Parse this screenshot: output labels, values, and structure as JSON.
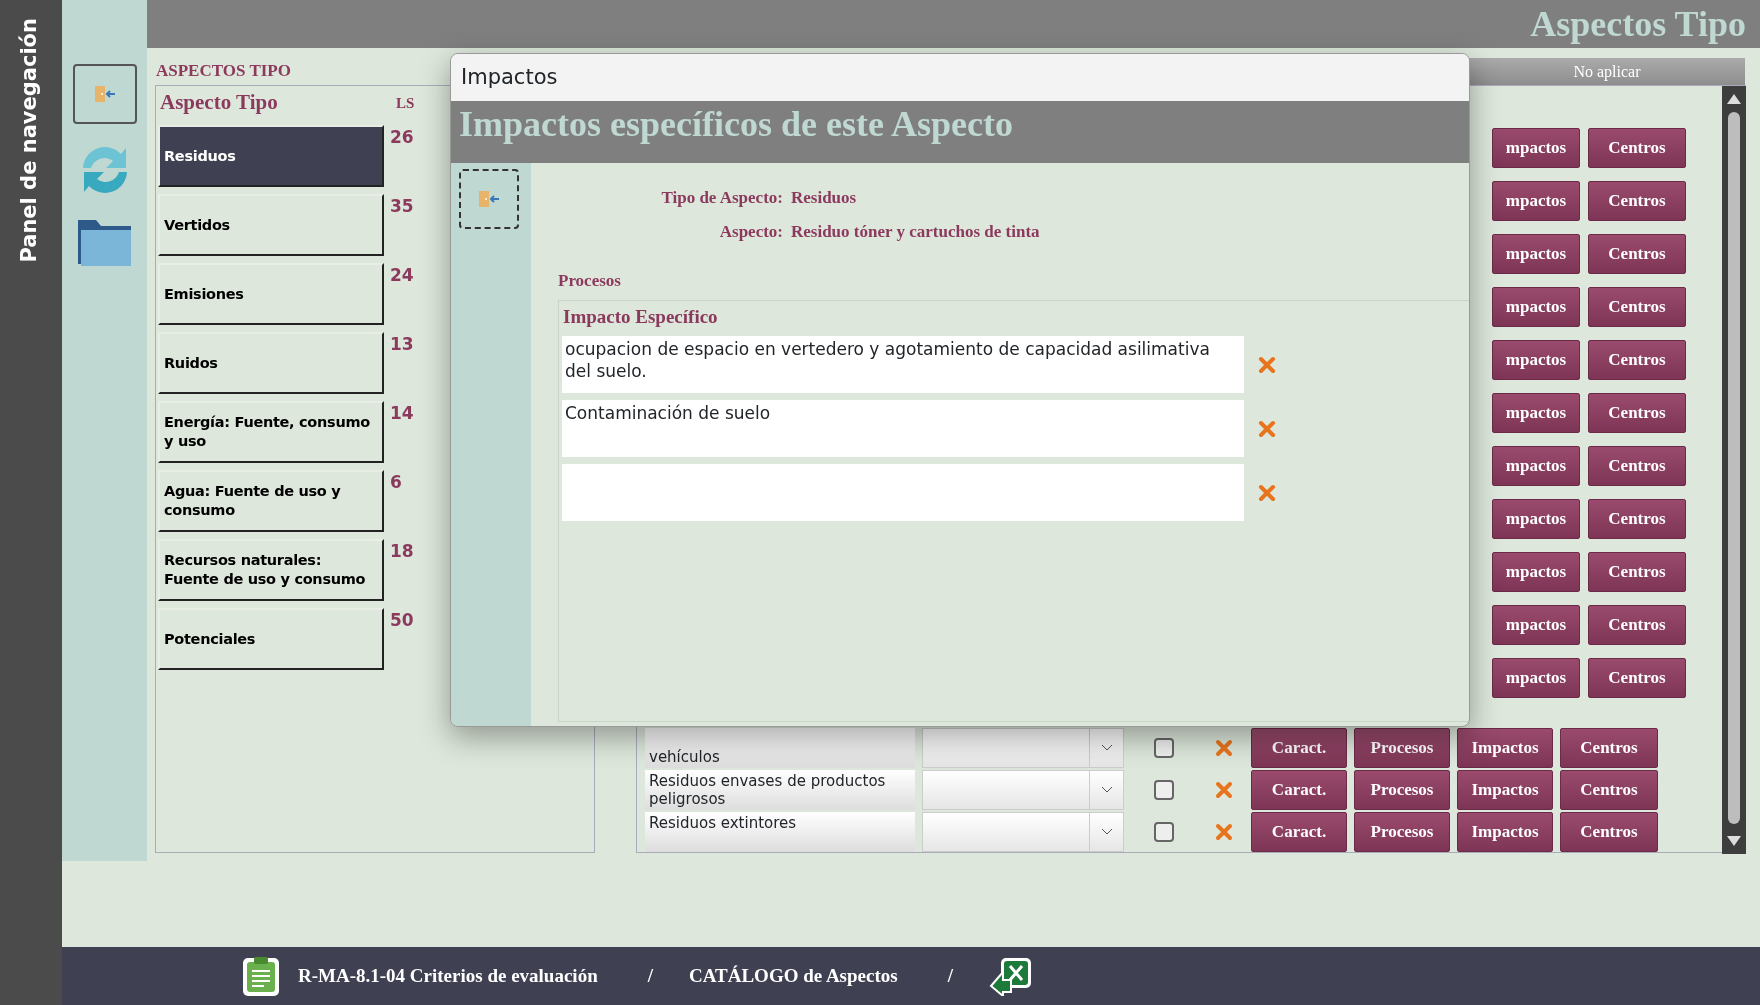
{
  "nav_panel": {
    "title": "Panel de navegación"
  },
  "header": {
    "title": "Aspectos Tipo"
  },
  "aspect_types": {
    "label": "ASPECTOS TIPO",
    "columns": [
      "Aspecto Tipo",
      "LS"
    ],
    "items": [
      {
        "name": "Residuos",
        "count": "26",
        "selected": true
      },
      {
        "name": "Vertidos",
        "count": "35",
        "selected": false
      },
      {
        "name": "Emisiones",
        "count": "24",
        "selected": false
      },
      {
        "name": "Ruidos",
        "count": "13",
        "selected": false
      },
      {
        "name": "Energía: Fuente, consumo y uso",
        "count": "14",
        "selected": false
      },
      {
        "name": "Agua: Fuente  de uso y consumo",
        "count": "6",
        "selected": false
      },
      {
        "name": "Recursos naturales: Fuente de uso  y consumo",
        "count": "18",
        "selected": false
      },
      {
        "name": "Potenciales",
        "count": "50",
        "selected": false
      }
    ]
  },
  "aspects_table": {
    "column_header": "No aplicar",
    "rows": [
      {
        "kind": "partial",
        "buttons": [
          "mpactos",
          "Centros"
        ]
      },
      {
        "kind": "partial",
        "buttons": [
          "mpactos",
          "Centros"
        ]
      },
      {
        "kind": "partial",
        "buttons": [
          "mpactos",
          "Centros"
        ]
      },
      {
        "kind": "partial",
        "buttons": [
          "mpactos",
          "Centros"
        ]
      },
      {
        "kind": "partial",
        "buttons": [
          "mpactos",
          "Centros"
        ]
      },
      {
        "kind": "partial",
        "buttons": [
          "mpactos",
          "Centros"
        ]
      },
      {
        "kind": "partial",
        "buttons": [
          "mpactos",
          "Centros"
        ]
      },
      {
        "kind": "partial",
        "buttons": [
          "mpactos",
          "Centros"
        ]
      },
      {
        "kind": "partial",
        "buttons": [
          "mpactos",
          "Centros"
        ]
      },
      {
        "kind": "partial",
        "buttons": [
          "mpactos",
          "Centros"
        ]
      },
      {
        "kind": "partial",
        "buttons": [
          "mpactos",
          "Centros"
        ]
      },
      {
        "kind": "full",
        "aspect": "vehículos",
        "checked": false,
        "buttons": [
          "Caract.",
          "Procesos",
          "Impactos",
          "Centros"
        ]
      },
      {
        "kind": "full",
        "aspect": "Residuos envases de productos peligrosos",
        "checked": false,
        "buttons": [
          "Caract.",
          "Procesos",
          "Impactos",
          "Centros"
        ]
      },
      {
        "kind": "full",
        "aspect": "Residuos extintores",
        "checked": false,
        "buttons": [
          "Caract.",
          "Procesos",
          "Impactos",
          "Centros"
        ]
      }
    ]
  },
  "dialog": {
    "title": "Impactos",
    "heading": "Impactos específicos de este Aspecto",
    "fields": [
      {
        "label": "Tipo de Aspecto:",
        "value": "Residuos"
      },
      {
        "label": "Aspecto:",
        "value": "Residuo tóner y cartuchos de tinta"
      }
    ],
    "section": "Procesos",
    "subform": {
      "header": "Impacto Específico",
      "rows": [
        {
          "kind": "record",
          "text": "ocupacion de espacio en vertedero y agotamiento de capacidad asilimativa del suelo."
        },
        {
          "kind": "record",
          "text": "Contaminación de suelo"
        },
        {
          "kind": "new"
        }
      ]
    }
  },
  "footer": {
    "items": [
      {
        "kind": "clipboard"
      },
      {
        "kind": "link",
        "text": "R-MA-8.1-04 Criterios de evaluación"
      },
      {
        "kind": "separator",
        "text": "/"
      },
      {
        "kind": "link",
        "text": "CATÁLOGO de Aspectos"
      },
      {
        "kind": "separator",
        "text": "/"
      },
      {
        "kind": "excel"
      }
    ]
  }
}
